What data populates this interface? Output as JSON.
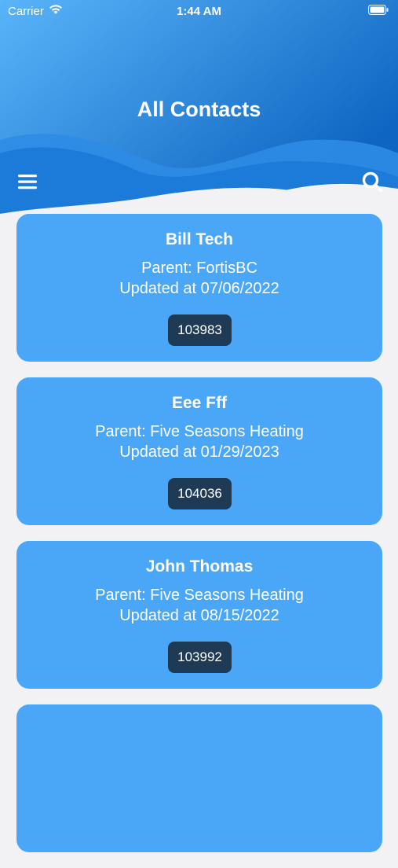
{
  "status_bar": {
    "carrier": "Carrier",
    "time": "1:44 AM",
    "wifi_icon": "wifi-icon",
    "battery_icon": "battery-icon"
  },
  "header": {
    "title": "All Contacts",
    "menu_icon": "hamburger-menu-icon",
    "search_icon": "search-icon"
  },
  "colors": {
    "header_gradient_start": "#5ab4f9",
    "header_gradient_end": "#0f66c2",
    "wave_light": "#2d8ce6",
    "card_background": "#4aa7f7",
    "id_badge_background": "#1f3a55",
    "page_background": "#f2f2f4"
  },
  "contacts": [
    {
      "name": "Bill Tech",
      "parent": "Parent: FortisBC",
      "updated": "Updated at 07/06/2022",
      "id": "103983"
    },
    {
      "name": "Eee Fff",
      "parent": "Parent: Five Seasons Heating",
      "updated": "Updated at 01/29/2023",
      "id": "104036"
    },
    {
      "name": "John Thomas",
      "parent": "Parent: Five Seasons Heating",
      "updated": "Updated at 08/15/2022",
      "id": "103992"
    }
  ]
}
